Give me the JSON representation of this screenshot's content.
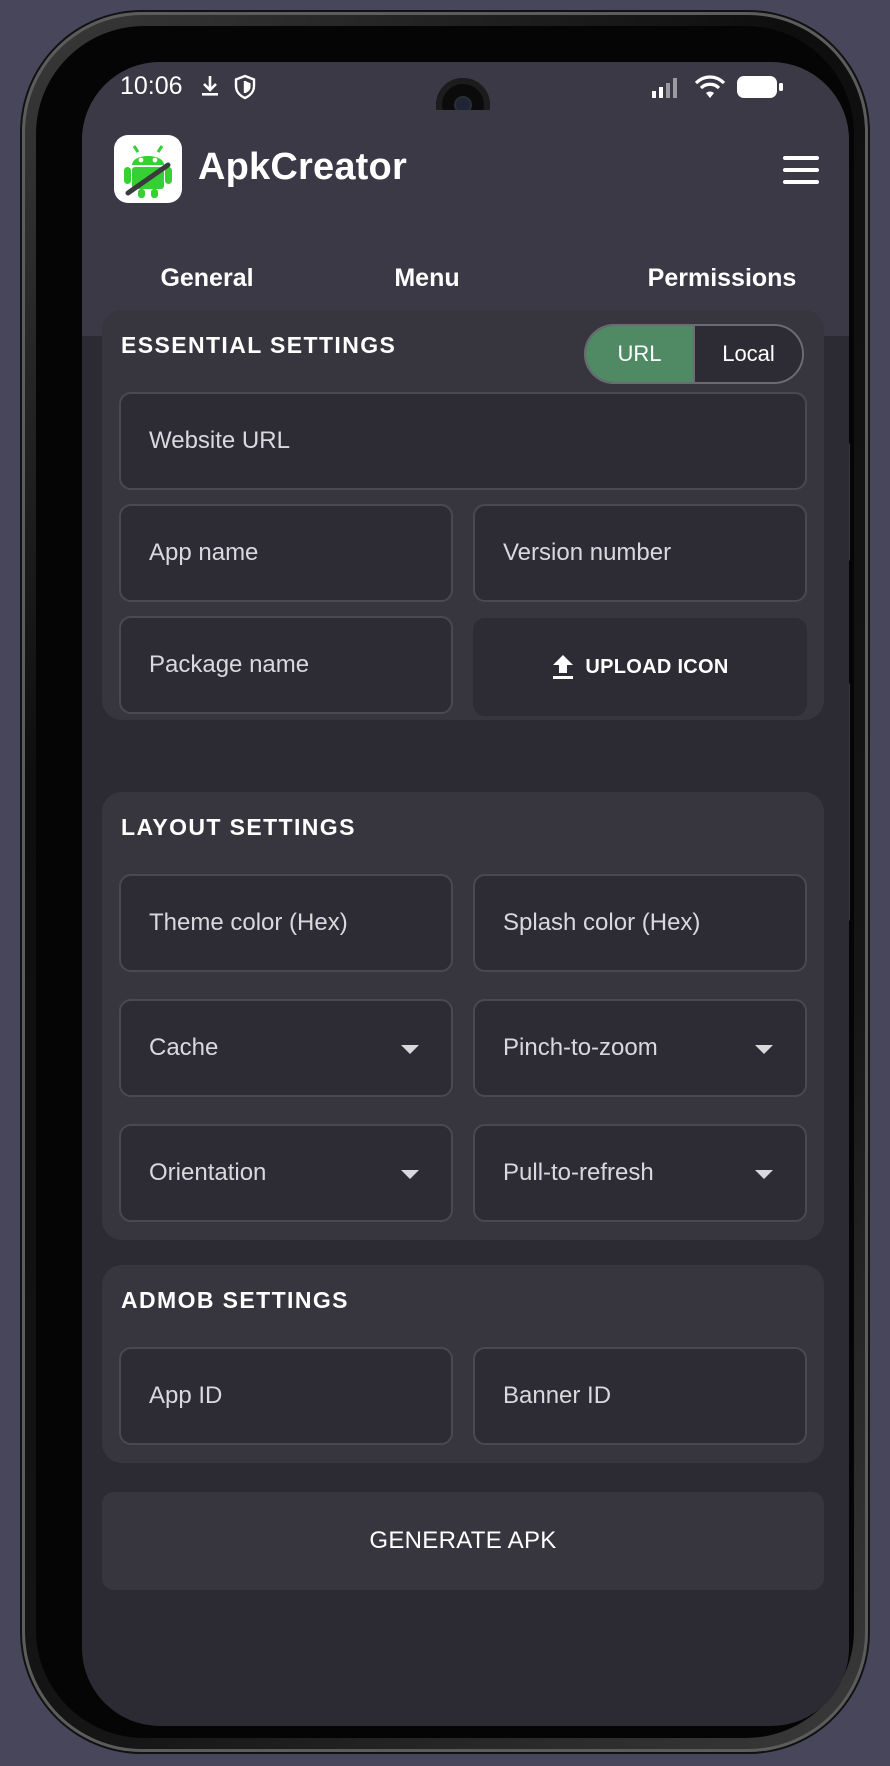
{
  "status": {
    "time": "10:06"
  },
  "app": {
    "title": "ApkCreator"
  },
  "tabs": [
    {
      "label": "General",
      "active": true
    },
    {
      "label": "Menu",
      "active": false
    },
    {
      "label": "Permissions",
      "active": false
    }
  ],
  "essential": {
    "title": "ESSENTIAL SETTINGS",
    "toggle": {
      "url": "URL",
      "local": "Local",
      "selected": "URL"
    },
    "website_url": "Website URL",
    "app_name": "App name",
    "version_number": "Version number",
    "package_name": "Package name",
    "upload_icon": "UPLOAD ICON"
  },
  "layout": {
    "title": "LAYOUT SETTINGS",
    "theme_color": "Theme color (Hex)",
    "splash_color": "Splash color (Hex)",
    "cache": "Cache",
    "pinch_to_zoom": "Pinch-to-zoom",
    "orientation": "Orientation",
    "pull_to_refresh": "Pull-to-refresh"
  },
  "admob": {
    "title": "ADMOB SETTINGS",
    "app_id": "App ID",
    "banner_id": "Banner ID"
  },
  "generate_label": "GENERATE APK",
  "colors": {
    "accent_green": "#4f8a64",
    "background": "#2c2b33",
    "header": "#3a3945",
    "card": "#37363f"
  }
}
